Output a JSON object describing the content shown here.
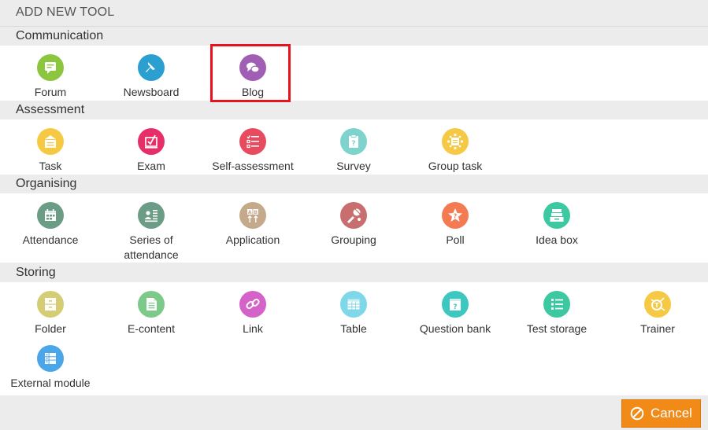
{
  "dialog": {
    "title": "ADD NEW TOOL"
  },
  "sections": [
    {
      "title": "Communication",
      "tools": [
        {
          "label": "Forum",
          "icon": "forum-icon",
          "color": "#8cc63f"
        },
        {
          "label": "Newsboard",
          "icon": "pin-icon",
          "color": "#2a9fd0"
        },
        {
          "label": "Blog",
          "icon": "blog-icon",
          "color": "#a05fb4",
          "selected": true
        }
      ]
    },
    {
      "title": "Assessment",
      "tools": [
        {
          "label": "Task",
          "icon": "task-icon",
          "color": "#f6c945"
        },
        {
          "label": "Exam",
          "icon": "exam-icon",
          "color": "#e62e68"
        },
        {
          "label": "Self-assessment",
          "icon": "self-assessment-icon",
          "color": "#e84a5f"
        },
        {
          "label": "Survey",
          "icon": "survey-icon",
          "color": "#7fd3cd"
        },
        {
          "label": "Group task",
          "icon": "group-task-icon",
          "color": "#f6c945"
        }
      ]
    },
    {
      "title": "Organising",
      "tools": [
        {
          "label": "Attendance",
          "icon": "attendance-icon",
          "color": "#6b9d86"
        },
        {
          "label": "Series of attendance",
          "label_line1": "Series of",
          "label_line2": "attendance",
          "icon": "series-attendance-icon",
          "color": "#6b9d86"
        },
        {
          "label": "Application",
          "icon": "application-icon",
          "color": "#c4a98a"
        },
        {
          "label": "Grouping",
          "icon": "grouping-icon",
          "color": "#c96e6e"
        },
        {
          "label": "Poll",
          "icon": "poll-icon",
          "color": "#f47a52"
        },
        {
          "label": "Idea box",
          "icon": "idea-box-icon",
          "color": "#3cc8a0"
        }
      ]
    },
    {
      "title": "Storing",
      "tools": [
        {
          "label": "Folder",
          "icon": "folder-icon",
          "color": "#d4cd74"
        },
        {
          "label": "E-content",
          "icon": "e-content-icon",
          "color": "#7cc98a"
        },
        {
          "label": "Link",
          "icon": "link-icon",
          "color": "#d562c8"
        },
        {
          "label": "Table",
          "icon": "table-icon",
          "color": "#7fd8e8"
        },
        {
          "label": "Question bank",
          "icon": "question-bank-icon",
          "color": "#3cc8c0"
        },
        {
          "label": "Test storage",
          "icon": "test-storage-icon",
          "color": "#3cc8a0"
        },
        {
          "label": "Trainer",
          "icon": "trainer-icon",
          "color": "#f6c945"
        },
        {
          "label": "External module",
          "icon": "external-module-icon",
          "color": "#4aa6e8"
        }
      ]
    }
  ],
  "footer": {
    "cancel_label": "Cancel",
    "cancel_icon": "cancel-icon",
    "cancel_color": "#f28a17"
  }
}
